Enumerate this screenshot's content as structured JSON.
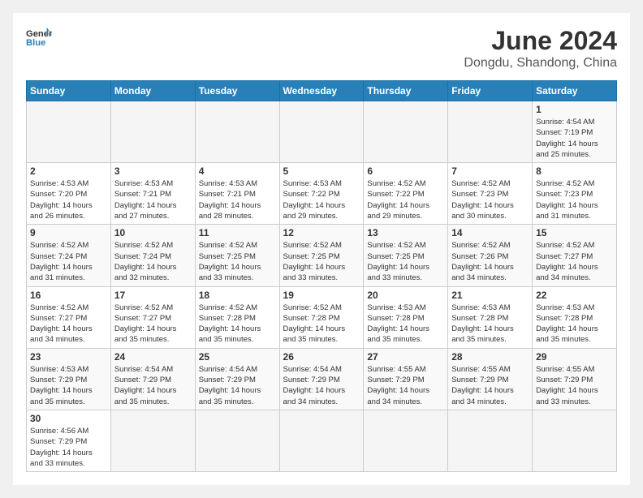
{
  "logo": {
    "text_general": "General",
    "text_blue": "Blue"
  },
  "title": "June 2024",
  "location": "Dongdu, Shandong, China",
  "days_of_week": [
    "Sunday",
    "Monday",
    "Tuesday",
    "Wednesday",
    "Thursday",
    "Friday",
    "Saturday"
  ],
  "weeks": [
    [
      {
        "day": "",
        "info": ""
      },
      {
        "day": "",
        "info": ""
      },
      {
        "day": "",
        "info": ""
      },
      {
        "day": "",
        "info": ""
      },
      {
        "day": "",
        "info": ""
      },
      {
        "day": "",
        "info": ""
      },
      {
        "day": "1",
        "info": "Sunrise: 4:54 AM\nSunset: 7:19 PM\nDaylight: 14 hours\nand 25 minutes."
      }
    ],
    [
      {
        "day": "2",
        "info": "Sunrise: 4:53 AM\nSunset: 7:20 PM\nDaylight: 14 hours\nand 26 minutes."
      },
      {
        "day": "3",
        "info": "Sunrise: 4:53 AM\nSunset: 7:21 PM\nDaylight: 14 hours\nand 27 minutes."
      },
      {
        "day": "4",
        "info": "Sunrise: 4:53 AM\nSunset: 7:21 PM\nDaylight: 14 hours\nand 28 minutes."
      },
      {
        "day": "5",
        "info": "Sunrise: 4:53 AM\nSunset: 7:22 PM\nDaylight: 14 hours\nand 29 minutes."
      },
      {
        "day": "6",
        "info": "Sunrise: 4:52 AM\nSunset: 7:22 PM\nDaylight: 14 hours\nand 29 minutes."
      },
      {
        "day": "7",
        "info": "Sunrise: 4:52 AM\nSunset: 7:23 PM\nDaylight: 14 hours\nand 30 minutes."
      },
      {
        "day": "8",
        "info": "Sunrise: 4:52 AM\nSunset: 7:23 PM\nDaylight: 14 hours\nand 31 minutes."
      }
    ],
    [
      {
        "day": "9",
        "info": "Sunrise: 4:52 AM\nSunset: 7:24 PM\nDaylight: 14 hours\nand 31 minutes."
      },
      {
        "day": "10",
        "info": "Sunrise: 4:52 AM\nSunset: 7:24 PM\nDaylight: 14 hours\nand 32 minutes."
      },
      {
        "day": "11",
        "info": "Sunrise: 4:52 AM\nSunset: 7:25 PM\nDaylight: 14 hours\nand 33 minutes."
      },
      {
        "day": "12",
        "info": "Sunrise: 4:52 AM\nSunset: 7:25 PM\nDaylight: 14 hours\nand 33 minutes."
      },
      {
        "day": "13",
        "info": "Sunrise: 4:52 AM\nSunset: 7:25 PM\nDaylight: 14 hours\nand 33 minutes."
      },
      {
        "day": "14",
        "info": "Sunrise: 4:52 AM\nSunset: 7:26 PM\nDaylight: 14 hours\nand 34 minutes."
      },
      {
        "day": "15",
        "info": "Sunrise: 4:52 AM\nSunset: 7:27 PM\nDaylight: 14 hours\nand 34 minutes."
      }
    ],
    [
      {
        "day": "16",
        "info": "Sunrise: 4:52 AM\nSunset: 7:27 PM\nDaylight: 14 hours\nand 34 minutes."
      },
      {
        "day": "17",
        "info": "Sunrise: 4:52 AM\nSunset: 7:27 PM\nDaylight: 14 hours\nand 35 minutes."
      },
      {
        "day": "18",
        "info": "Sunrise: 4:52 AM\nSunset: 7:28 PM\nDaylight: 14 hours\nand 35 minutes."
      },
      {
        "day": "19",
        "info": "Sunrise: 4:52 AM\nSunset: 7:28 PM\nDaylight: 14 hours\nand 35 minutes."
      },
      {
        "day": "20",
        "info": "Sunrise: 4:53 AM\nSunset: 7:28 PM\nDaylight: 14 hours\nand 35 minutes."
      },
      {
        "day": "21",
        "info": "Sunrise: 4:53 AM\nSunset: 7:28 PM\nDaylight: 14 hours\nand 35 minutes."
      },
      {
        "day": "22",
        "info": "Sunrise: 4:53 AM\nSunset: 7:28 PM\nDaylight: 14 hours\nand 35 minutes."
      }
    ],
    [
      {
        "day": "23",
        "info": "Sunrise: 4:53 AM\nSunset: 7:29 PM\nDaylight: 14 hours\nand 35 minutes."
      },
      {
        "day": "24",
        "info": "Sunrise: 4:54 AM\nSunset: 7:29 PM\nDaylight: 14 hours\nand 35 minutes."
      },
      {
        "day": "25",
        "info": "Sunrise: 4:54 AM\nSunset: 7:29 PM\nDaylight: 14 hours\nand 35 minutes."
      },
      {
        "day": "26",
        "info": "Sunrise: 4:54 AM\nSunset: 7:29 PM\nDaylight: 14 hours\nand 34 minutes."
      },
      {
        "day": "27",
        "info": "Sunrise: 4:55 AM\nSunset: 7:29 PM\nDaylight: 14 hours\nand 34 minutes."
      },
      {
        "day": "28",
        "info": "Sunrise: 4:55 AM\nSunset: 7:29 PM\nDaylight: 14 hours\nand 34 minutes."
      },
      {
        "day": "29",
        "info": "Sunrise: 4:55 AM\nSunset: 7:29 PM\nDaylight: 14 hours\nand 33 minutes."
      }
    ],
    [
      {
        "day": "30",
        "info": "Sunrise: 4:56 AM\nSunset: 7:29 PM\nDaylight: 14 hours\nand 33 minutes."
      },
      {
        "day": "",
        "info": ""
      },
      {
        "day": "",
        "info": ""
      },
      {
        "day": "",
        "info": ""
      },
      {
        "day": "",
        "info": ""
      },
      {
        "day": "",
        "info": ""
      },
      {
        "day": "",
        "info": ""
      }
    ]
  ]
}
